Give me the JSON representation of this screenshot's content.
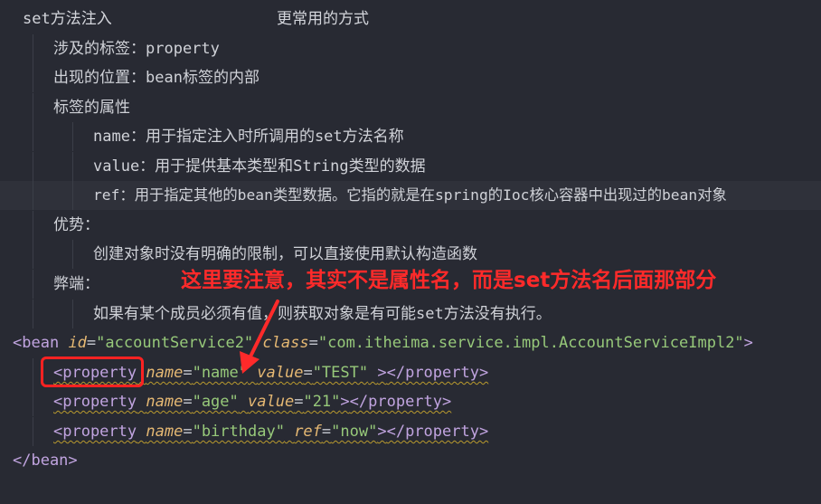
{
  "notes": {
    "title": "set方法注入",
    "title_right": "更常用的方式",
    "tags_involved": "涉及的标签：property",
    "position": "出现的位置：bean标签的内部",
    "tag_attrs": "标签的属性",
    "attr_name": "name：用于指定注入时所调用的set方法名称",
    "attr_value": "value：用于提供基本类型和String类型的数据",
    "attr_ref": "ref：用于指定其他的bean类型数据。它指的就是在spring的Ioc核心容器中出现过的bean对象",
    "advantage": "优势：",
    "advantage_text": "创建对象时没有明确的限制，可以直接使用默认构造函数",
    "disadvantage": "弊端：",
    "disadvantage_text": "如果有某个成员必须有值，则获取对象是有可能set方法没有执行。"
  },
  "annotation": {
    "text": "这里要注意，其实不是属性名，而是set方法名后面那部分",
    "color": "#ff2a2a"
  },
  "code": {
    "bean_open": "<bean",
    "bean_id_attr": "id",
    "bean_id_val": "\"accountService2\"",
    "bean_class_attr": "class",
    "bean_class_val": "\"com.itheima.service.impl.AccountServiceImpl2\"",
    "bean_open_end": ">",
    "prop_open": "<property",
    "prop_close": "</property>",
    "name_attr": "name",
    "value_attr": "value",
    "ref_attr": "ref",
    "p1_name": "\"name\"",
    "p1_value": "\"TEST\"",
    "p2_name": "\"age\"",
    "p2_value": "\"21\"",
    "p3_name": "\"birthday\"",
    "p3_ref": "\"now\"",
    "eq": "=",
    "gt": ">",
    "bean_close": "</bean>"
  },
  "colors": {
    "background": "#282a33",
    "tag": "#c1a4e0",
    "attribute": "#e5b873",
    "string": "#97c97a",
    "highlight_box": "#ff2222"
  }
}
